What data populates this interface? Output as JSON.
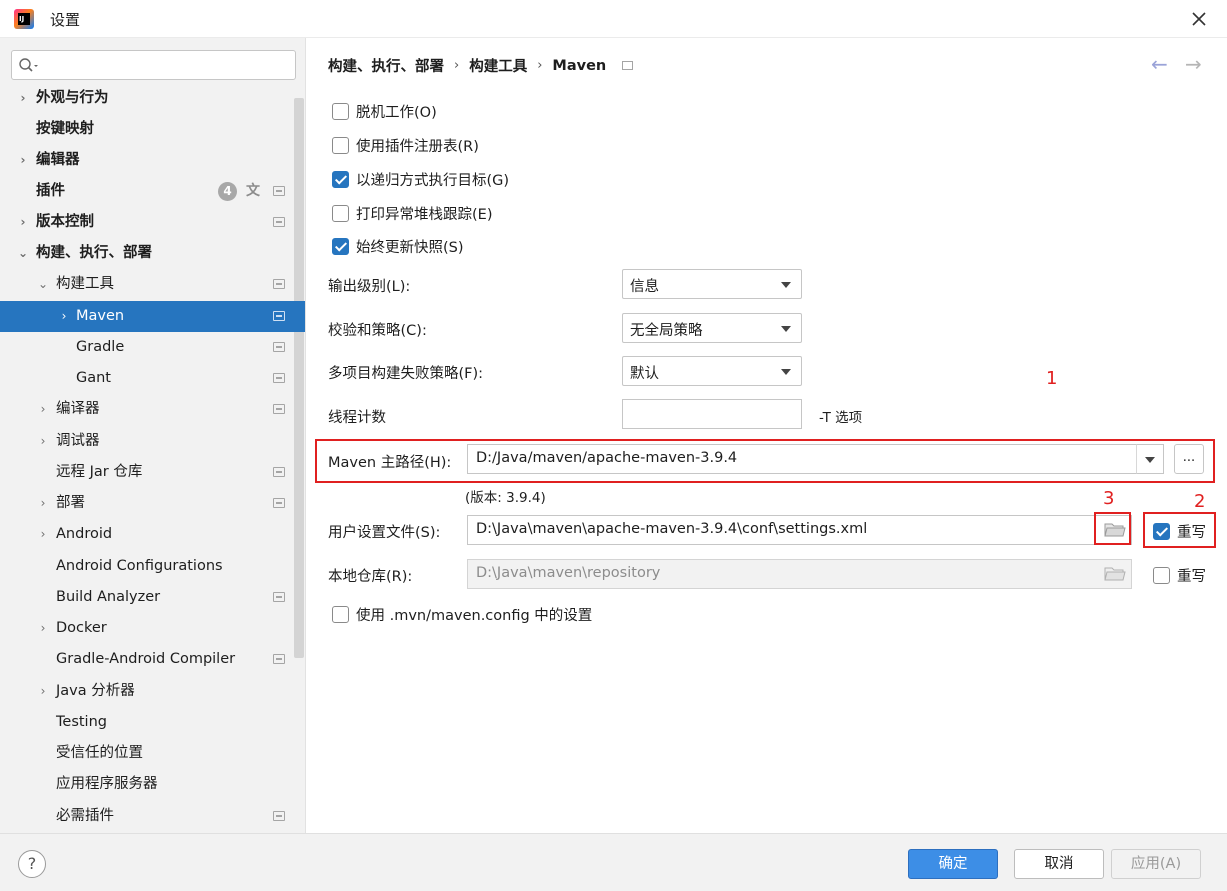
{
  "window": {
    "title": "设置"
  },
  "search": {
    "placeholder": ""
  },
  "sidebar": {
    "plugin_badge": "4",
    "items": [
      {
        "label": "外观与行为"
      },
      {
        "label": "按键映射"
      },
      {
        "label": "编辑器"
      },
      {
        "label": "插件"
      },
      {
        "label": "版本控制"
      },
      {
        "label": "构建、执行、部署"
      },
      {
        "label": "构建工具"
      },
      {
        "label": "Maven"
      },
      {
        "label": "Gradle"
      },
      {
        "label": "Gant"
      },
      {
        "label": "编译器"
      },
      {
        "label": "调试器"
      },
      {
        "label": "远程 Jar 仓库"
      },
      {
        "label": "部署"
      },
      {
        "label": "Android"
      },
      {
        "label": "Android Configurations"
      },
      {
        "label": "Build Analyzer"
      },
      {
        "label": "Docker"
      },
      {
        "label": "Gradle-Android Compiler"
      },
      {
        "label": "Java 分析器"
      },
      {
        "label": "Testing"
      },
      {
        "label": "受信任的位置"
      },
      {
        "label": "应用程序服务器"
      },
      {
        "label": "必需插件"
      }
    ]
  },
  "breadcrumb": [
    "构建、执行、部署",
    "构建工具",
    "Maven"
  ],
  "options": {
    "offline": {
      "label": "脱机工作(O)",
      "checked": false
    },
    "plugin_registry": {
      "label": "使用插件注册表(R)",
      "checked": false
    },
    "recursive": {
      "label": "以递归方式执行目标(G)",
      "checked": true
    },
    "print_stack": {
      "label": "打印异常堆栈跟踪(E)",
      "checked": false
    },
    "always_update": {
      "label": "始终更新快照(S)",
      "checked": true
    },
    "use_mvn_config": {
      "label": "使用 .mvn/maven.config 中的设置",
      "checked": false
    }
  },
  "fields": {
    "output_level": {
      "label": "输出级别(L):",
      "value": "信息"
    },
    "checksum": {
      "label": "校验和策略(C):",
      "value": "无全局策略"
    },
    "fail_policy": {
      "label": "多项目构建失败策略(F):",
      "value": "默认"
    },
    "threads": {
      "label": "线程计数",
      "value": "",
      "hint": "-T 选项"
    },
    "maven_home": {
      "label": "Maven 主路径(H):",
      "value": "D:/Java/maven/apache-maven-3.9.4",
      "version": "(版本: 3.9.4)",
      "browse": "..."
    },
    "user_settings": {
      "label": "用户设置文件(S):",
      "value": "D:\\Java\\maven\\apache-maven-3.9.4\\conf\\settings.xml",
      "override_label": "重写",
      "override_checked": true
    },
    "local_repo": {
      "label": "本地仓库(R):",
      "value": "D:\\Java\\maven\\repository",
      "override_label": "重写",
      "override_checked": false
    }
  },
  "annotations": {
    "n1": "1",
    "n2": "2",
    "n3": "3",
    "color": "#e02020"
  },
  "footer": {
    "help": "?",
    "ok": "确定",
    "cancel": "取消",
    "apply": "应用(A)"
  },
  "colors": {
    "accent": "#2675bf",
    "ok_button": "#3d8ee6"
  }
}
